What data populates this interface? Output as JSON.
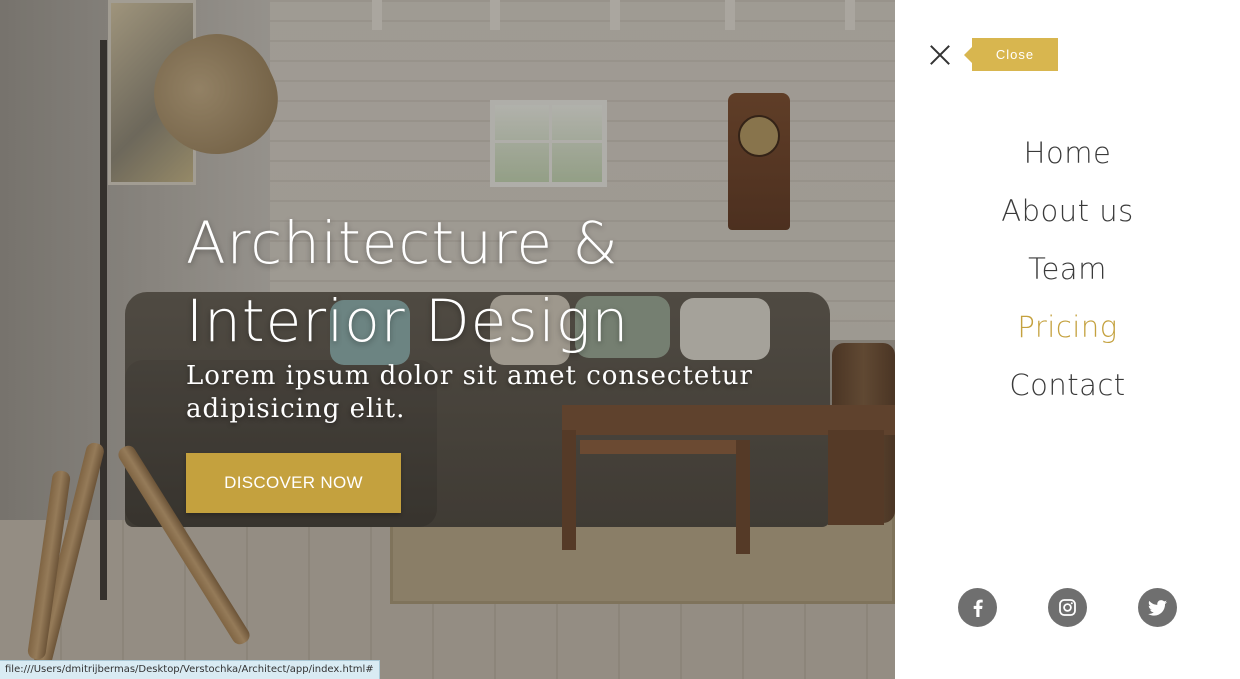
{
  "hero": {
    "title_line1": "Architecture &",
    "title_line2": "Interior Design",
    "subtitle": "Lorem ipsum dolor sit amet consectetur adipisicing elit.",
    "cta_label": "DISCOVER NOW"
  },
  "menu": {
    "close_label": "Close",
    "items": [
      {
        "label": "Home"
      },
      {
        "label": "About us"
      },
      {
        "label": "Team"
      },
      {
        "label": "Pricing"
      },
      {
        "label": "Contact"
      }
    ],
    "active_item": "Pricing",
    "social": [
      {
        "icon": "facebook-icon"
      },
      {
        "icon": "instagram-icon"
      },
      {
        "icon": "twitter-icon"
      }
    ]
  },
  "status_bar": {
    "url": "file:///Users/dmitrijbermas/Desktop/Verstochka/Architect/app/index.html#"
  },
  "colors": {
    "accent": "#c4a13e",
    "tooltip": "#d8b64f",
    "nav_text": "#3a3a3a",
    "social_bg": "#6f6f6f"
  }
}
